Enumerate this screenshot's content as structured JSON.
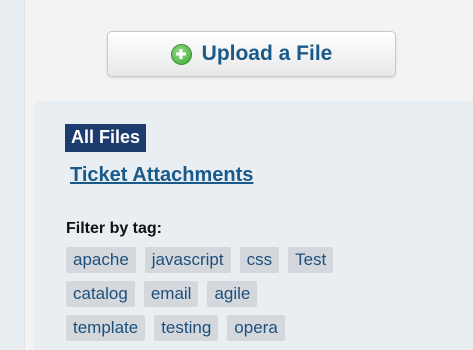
{
  "upload": {
    "label": "Upload a File",
    "icon": "plus-circle-icon"
  },
  "nav": {
    "active_item": "All Files",
    "secondary_item": "Ticket Attachments"
  },
  "filter": {
    "label": "Filter by tag:",
    "tags": [
      [
        "apache",
        "javascript",
        "css",
        "Test"
      ],
      [
        "catalog",
        "email",
        "agile"
      ],
      [
        "template",
        "testing",
        "opera"
      ]
    ]
  },
  "colors": {
    "link": "#1a5a8a",
    "active_bg": "#1d3c6e",
    "tag_bg": "#d4d8dc",
    "icon_green": "#3fa635"
  }
}
